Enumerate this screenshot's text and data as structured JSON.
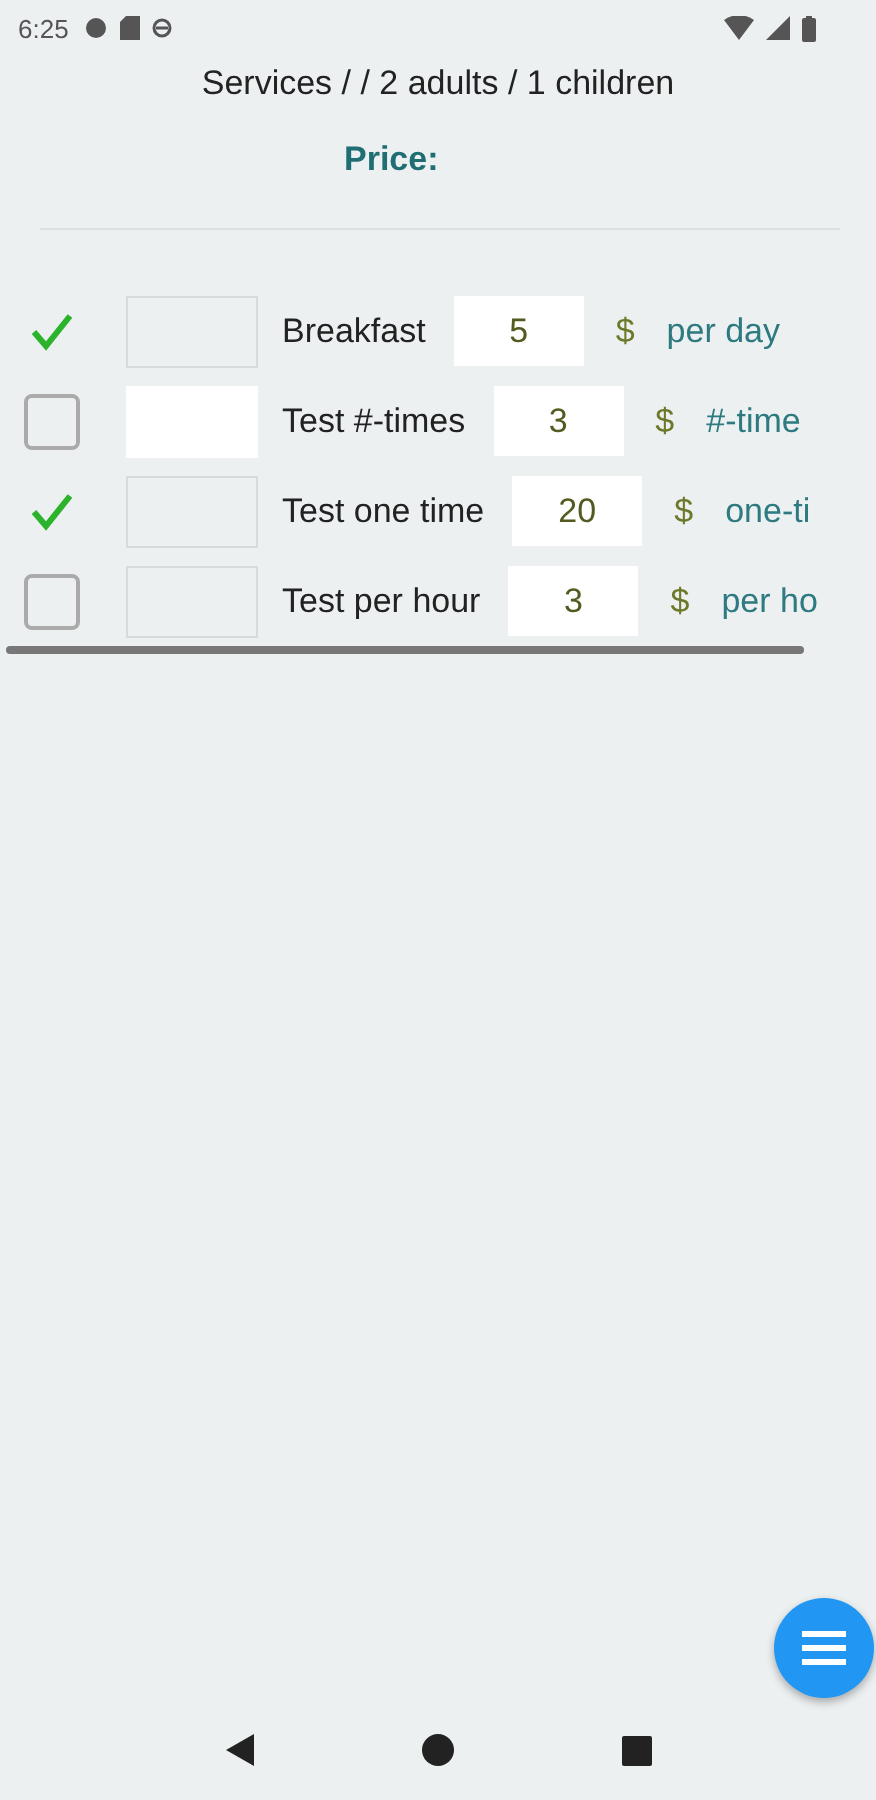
{
  "status_bar": {
    "time": "6:25"
  },
  "header": {
    "title": "Services /  / 2 adults / 1 children",
    "price_label": "Price:"
  },
  "services": [
    {
      "checked": true,
      "note_editable": false,
      "name": "Breakfast",
      "price": "5",
      "currency": "$",
      "unit": "per day"
    },
    {
      "checked": false,
      "note_editable": true,
      "name": "Test #-times",
      "price": "3",
      "currency": "$",
      "unit": "#-time"
    },
    {
      "checked": true,
      "note_editable": false,
      "name": "Test one time",
      "price": "20",
      "currency": "$",
      "unit": "one-ti"
    },
    {
      "checked": false,
      "note_editable": false,
      "name": "Test per hour",
      "price": "3",
      "currency": "$",
      "unit": "per ho"
    }
  ]
}
